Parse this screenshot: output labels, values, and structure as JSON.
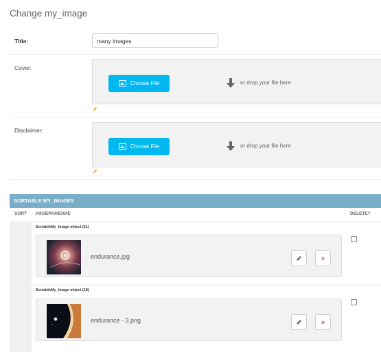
{
  "page": {
    "title": "Change my_image"
  },
  "form": {
    "title_label": "Title:",
    "title_value": "many images",
    "cover_label": "Cover:",
    "disclaimer_label": "Disclaimer:",
    "choose_file_label": "Choose File",
    "drop_text": "or drop your file here"
  },
  "inline": {
    "header": "SORTABLE MY_IMAGES",
    "columns": {
      "sort": "SORT",
      "image": "ИЗОБРАЖЕНИЕ",
      "delete": "DELETE?"
    },
    "rows": [
      {
        "object_label": "SortableMy_Image object (21)",
        "file_name": "endurance.jpg"
      },
      {
        "object_label": "SortableMy_Image object (18)",
        "file_name": "endurance - 3.png"
      }
    ]
  },
  "colors": {
    "accent": "#00b8f0",
    "inline_header": "#79aec8"
  }
}
